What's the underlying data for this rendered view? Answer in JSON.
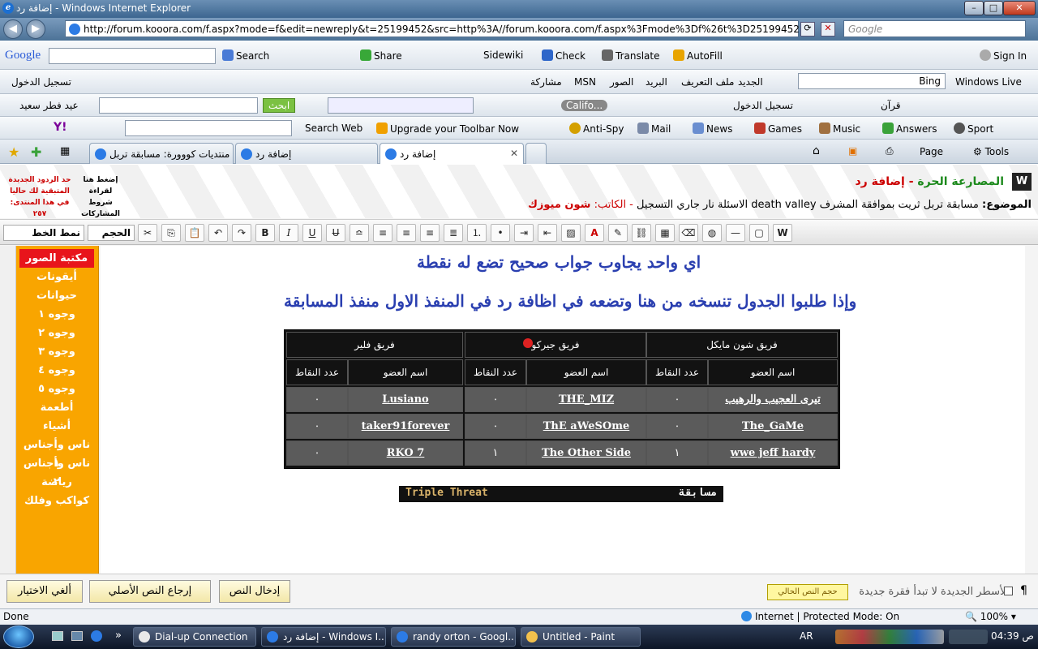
{
  "window": {
    "title": "إضافة رد - Windows Internet Explorer"
  },
  "address": {
    "url": "http://forum.kooora.com/f.aspx?mode=f&edit=newreply&t=25199452&src=http%3A//forum.kooora.com/f.aspx%3Fmode%3Df%26t%3D25199452",
    "search_placeholder": "Google"
  },
  "google_toolbar": {
    "logo": "Google",
    "search": "Search",
    "share": "Share",
    "sidewiki": "Sidewiki",
    "check": "Check",
    "translate": "Translate",
    "autofill": "AutoFill",
    "signin": "Sign In"
  },
  "live_toolbar": {
    "register": "تسجيل الدخول",
    "links": [
      "مشاركة",
      "MSN",
      "الصور",
      "البريد",
      "ملف التعريف",
      "الجديد"
    ],
    "search_value": "Bing",
    "brand": "Windows Live"
  },
  "arabic_toolbar": {
    "user": "عيد فطر سعيد",
    "search_btn": "ابحث",
    "radio": "Califo...",
    "login": "تسجيل الدخول",
    "quran": "قرآن"
  },
  "yahoo_toolbar": {
    "search_web": "Search Web",
    "upgrade": "Upgrade your Toolbar Now",
    "antispy": "Anti-Spy",
    "mail": "Mail",
    "news": "News",
    "games": "Games",
    "music": "Music",
    "answers": "Answers",
    "sport": "Sport"
  },
  "tabs": [
    {
      "label": "منتديات كووورة: مسابقة تربل ..."
    },
    {
      "label": "إضافة رد"
    },
    {
      "label": "إضافة رد"
    }
  ],
  "command_bar": {
    "page": "Page",
    "tools": "Tools"
  },
  "forum": {
    "section": "المصارعة الحرة",
    "action": "إضافة رد",
    "topic_label": "الموضوع:",
    "topic": "مسابقة تربل ثريت بموافقة المشرف death valley الاسئلة نار جاري التسجيل",
    "author_label": "- الكاتب:",
    "author": "شون ميوزك",
    "rules_line1": "إضغط هنا",
    "rules_line2": "لقراءة شروط",
    "rules_line3": "المشاركات",
    "replies_line1": "حد الردود الجديدة",
    "replies_line2": "المتبقية لك حاليا",
    "replies_line3": "في هذا المنتدى: ٢٥٧"
  },
  "editor": {
    "font_select": "نمط الخط",
    "size_select": "الحجم"
  },
  "sidebar": {
    "items": [
      "مكتبة الصور",
      "أيقونات",
      "حيوانات",
      "وجوه ١",
      "وجوه ٢",
      "وجوه ٣",
      "وجوه ٤",
      "وجوه ٥",
      "أطعمة",
      "أشياء",
      "ناس وأجناس ١",
      "ناس وأجناس ٢",
      "رياضة",
      "كواكب وفلك"
    ]
  },
  "post": {
    "line1": "اي واحد يجاوب جواب صحيح تضع له نقطة",
    "line2": "وإذا طلبوا الجدول تنسخه من هنا وتضعه في اظافة رد في المنفذ الاول منفذ المسابقة",
    "teams": [
      "فريق شون مايكل",
      "فريق جيركو",
      "فريق فلير"
    ],
    "col_member": "اسم العضو",
    "col_points": "عدد النقاط",
    "rows": [
      [
        {
          "name": "تيرى العجيب والرهيب",
          "pts": "٠"
        },
        {
          "name": "THE_MIZ",
          "pts": "٠"
        },
        {
          "name": "Lusiano",
          "pts": "٠"
        }
      ],
      [
        {
          "name": "The_GaMe",
          "pts": "٠"
        },
        {
          "name": "ThE aWeSOme",
          "pts": "٠"
        },
        {
          "name": "taker91forever",
          "pts": "٠"
        }
      ],
      [
        {
          "name": "wwe jeff hardy",
          "pts": "١"
        },
        {
          "name": "The Other Side",
          "pts": "١"
        },
        {
          "name": "RKO 7",
          "pts": "٠"
        }
      ]
    ],
    "banner_left": "Triple Threat",
    "banner_right": "مسابقة"
  },
  "bottom": {
    "submit": "إدخال النص",
    "restore": "إرجاع النص الأصلي",
    "cancel": "ألغي الاختيار",
    "size_label": "حجم النص الحالي",
    "newline_option": "الأسطر الجديدة لا تبدأ فقرة جديدة"
  },
  "status": {
    "left": "Done",
    "zone": "Internet | Protected Mode: On",
    "zoom": "100%"
  },
  "taskbar": {
    "tasks": [
      "Dial-up Connection",
      "إضافة رد - Windows I...",
      "randy orton - Googl...",
      "Untitled - Paint"
    ],
    "lang": "AR",
    "clock": "04:39 ص"
  },
  "colors": {
    "accent": "#f9a500",
    "heading": "#2a3fb0",
    "active_library": "#e8141b"
  }
}
